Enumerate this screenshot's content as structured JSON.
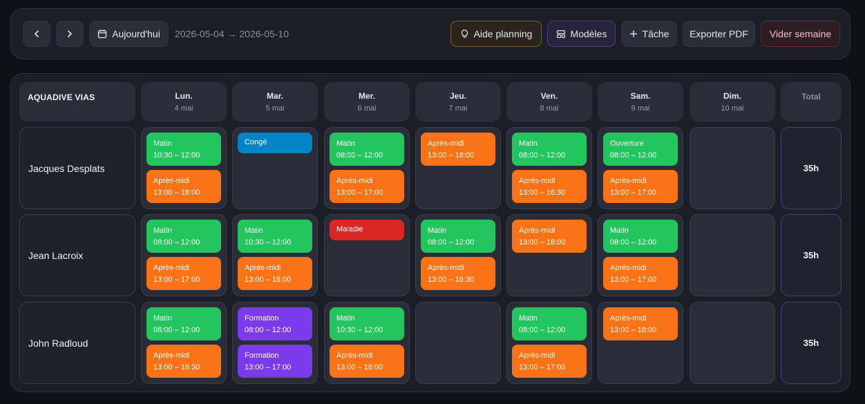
{
  "toolbar": {
    "prev_label": "‹",
    "next_label": "›",
    "today_label": "Aujourd'hui",
    "range_text": "2026-05-04 → 2026-05-10",
    "aide_label": "Aide planning",
    "modeles_label": "Modèles",
    "tache_label": "Tâche",
    "export_label": "Exporter PDF",
    "vider_label": "Vider semaine"
  },
  "grid": {
    "company": "AQUADIVE VIAS",
    "total_header": "Total",
    "days": [
      {
        "name": "Lun.",
        "date": "4 mai"
      },
      {
        "name": "Mar.",
        "date": "5 mai"
      },
      {
        "name": "Mer.",
        "date": "6 mai"
      },
      {
        "name": "Jeu.",
        "date": "7 mai"
      },
      {
        "name": "Ven.",
        "date": "8 mai"
      },
      {
        "name": "Sam.",
        "date": "9 mai"
      },
      {
        "name": "Dim.",
        "date": "10 mai"
      }
    ],
    "employees": [
      {
        "name": "Jacques Desplats",
        "total": "35h",
        "days": [
          [
            {
              "label": "Matin",
              "time": "10:30 – 12:00",
              "color": "green"
            },
            {
              "label": "Après-midi",
              "time": "13:00 – 18:00",
              "color": "orange"
            }
          ],
          [
            {
              "label": "Congé",
              "time": "",
              "color": "blue"
            }
          ],
          [
            {
              "label": "Matin",
              "time": "08:00 – 12:00",
              "color": "green"
            },
            {
              "label": "Après-midi",
              "time": "13:00 – 17:00",
              "color": "orange"
            }
          ],
          [
            {
              "label": "Après-midi",
              "time": "13:00 – 18:00",
              "color": "orange"
            }
          ],
          [
            {
              "label": "Matin",
              "time": "08:00 – 12:00",
              "color": "green"
            },
            {
              "label": "Après-midi",
              "time": "13:00 – 16:30",
              "color": "orange"
            }
          ],
          [
            {
              "label": "Ouverture",
              "time": "08:00 – 12:00",
              "color": "green"
            },
            {
              "label": "Après-midi",
              "time": "13:00 – 17:00",
              "color": "orange"
            }
          ],
          []
        ]
      },
      {
        "name": "Jean Lacroix",
        "total": "35h",
        "days": [
          [
            {
              "label": "Matin",
              "time": "08:00 – 12:00",
              "color": "green"
            },
            {
              "label": "Après-midi",
              "time": "13:00 – 17:00",
              "color": "orange"
            }
          ],
          [
            {
              "label": "Matin",
              "time": "10:30 – 12:00",
              "color": "green"
            },
            {
              "label": "Après-midi",
              "time": "13:00 – 18:00",
              "color": "orange"
            }
          ],
          [
            {
              "label": "Maladie",
              "time": "",
              "color": "red"
            }
          ],
          [
            {
              "label": "Matin",
              "time": "08:00 – 12:00",
              "color": "green"
            },
            {
              "label": "Après-midi",
              "time": "13:00 – 16:30",
              "color": "orange"
            }
          ],
          [
            {
              "label": "Après-midi",
              "time": "13:00 – 18:00",
              "color": "orange"
            }
          ],
          [
            {
              "label": "Matin",
              "time": "08:00 – 12:00",
              "color": "green"
            },
            {
              "label": "Après-midi",
              "time": "13:00 – 17:00",
              "color": "orange"
            }
          ],
          []
        ]
      },
      {
        "name": "John Radloud",
        "total": "35h",
        "days": [
          [
            {
              "label": "Matin",
              "time": "08:00 – 12:00",
              "color": "green"
            },
            {
              "label": "Après-midi",
              "time": "13:00 – 16:30",
              "color": "orange"
            }
          ],
          [
            {
              "label": "Formation",
              "time": "08:00 – 12:00",
              "color": "purple"
            },
            {
              "label": "Formation",
              "time": "13:00 – 17:00",
              "color": "purple"
            }
          ],
          [
            {
              "label": "Matin",
              "time": "10:30 – 12:00",
              "color": "green"
            },
            {
              "label": "Après-midi",
              "time": "13:00 – 18:00",
              "color": "orange"
            }
          ],
          [],
          [
            {
              "label": "Matin",
              "time": "08:00 – 12:00",
              "color": "green"
            },
            {
              "label": "Après-midi",
              "time": "13:00 – 17:00",
              "color": "orange"
            }
          ],
          [
            {
              "label": "Après-midi",
              "time": "13:00 – 18:00",
              "color": "orange"
            }
          ],
          []
        ]
      }
    ]
  },
  "colors": {
    "background": "#0e1117",
    "green": "#22c55e",
    "orange": "#f97316",
    "blue": "#0284c7",
    "red": "#dc2626",
    "purple": "#7c3aed"
  },
  "icons": {
    "prev": "chevron-left-icon",
    "next": "chevron-right-icon",
    "today": "calendar-icon",
    "aide": "lightbulb-icon",
    "modeles": "layout-template-icon",
    "tache": "plus-icon"
  }
}
